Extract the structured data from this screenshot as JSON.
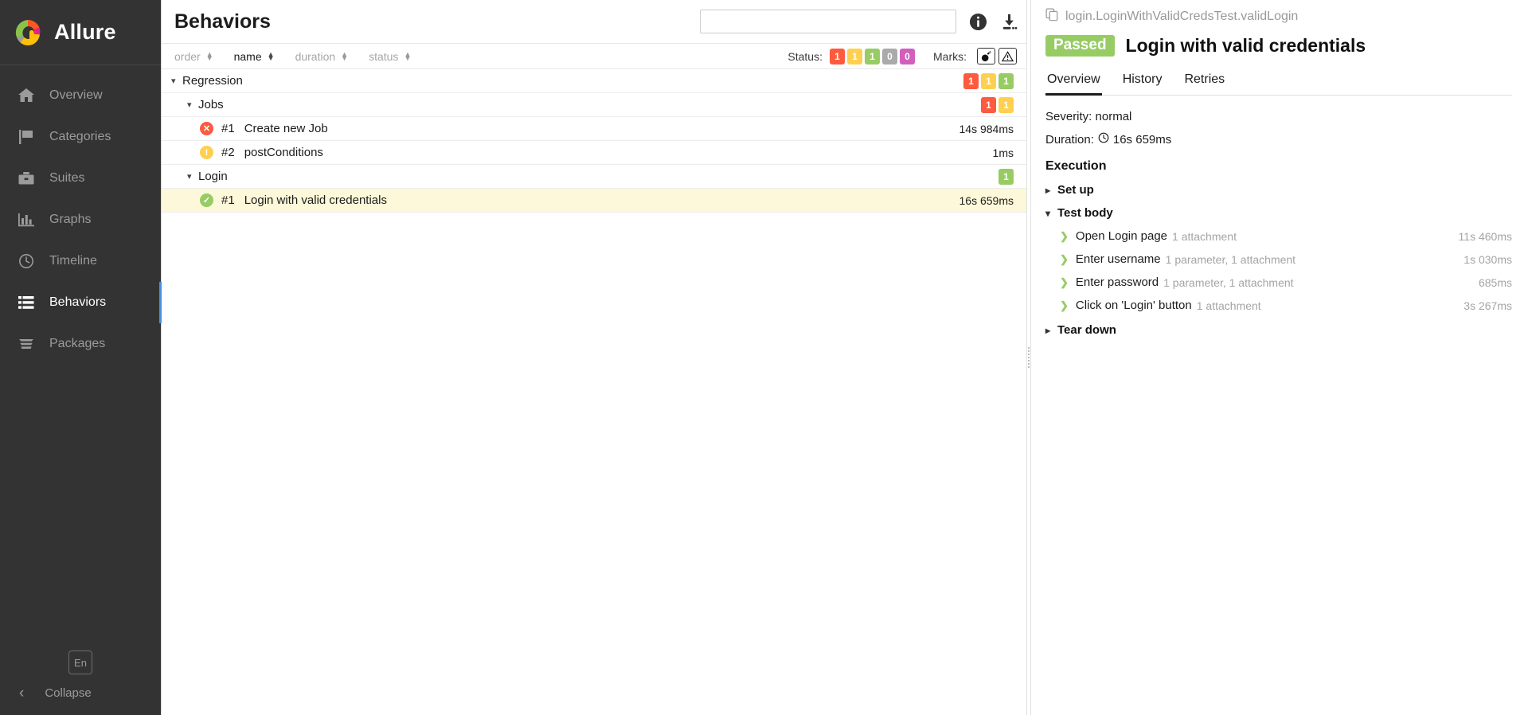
{
  "brand": {
    "name": "Allure",
    "logo_colors": [
      "#8bc34a",
      "#ff5722",
      "#e91e8c",
      "#ffc107",
      "#9e9e9e"
    ]
  },
  "sidebar": {
    "items": [
      {
        "label": "Overview",
        "icon": "home-icon",
        "active": false
      },
      {
        "label": "Categories",
        "icon": "flag-icon",
        "active": false
      },
      {
        "label": "Suites",
        "icon": "briefcase-icon",
        "active": false
      },
      {
        "label": "Graphs",
        "icon": "bar-chart-icon",
        "active": false
      },
      {
        "label": "Timeline",
        "icon": "clock-icon",
        "active": false
      },
      {
        "label": "Behaviors",
        "icon": "list-icon",
        "active": true
      },
      {
        "label": "Packages",
        "icon": "layers-icon",
        "active": false
      }
    ],
    "language_button": "En",
    "collapse_label": "Collapse"
  },
  "header": {
    "title": "Behaviors",
    "search_value": "",
    "search_placeholder": "",
    "info_icon": "info-icon",
    "download_icon": "download-icon"
  },
  "sortbar": {
    "sorters": [
      {
        "label": "order",
        "active": false
      },
      {
        "label": "name",
        "active": true
      },
      {
        "label": "duration",
        "active": false
      },
      {
        "label": "status",
        "active": false
      }
    ],
    "status_label": "Status:",
    "status_chips": [
      {
        "value": "1",
        "color": "#fd5a3e",
        "name": "failed"
      },
      {
        "value": "1",
        "color": "#ffd050",
        "name": "broken"
      },
      {
        "value": "1",
        "color": "#97cc64",
        "name": "passed"
      },
      {
        "value": "0",
        "color": "#aaaaaa",
        "name": "skipped"
      },
      {
        "value": "0",
        "color": "#d35ebe",
        "name": "unknown"
      }
    ],
    "marks_label": "Marks:",
    "marks": [
      {
        "name": "flaky-bomb-icon"
      },
      {
        "name": "warning-triangle-icon"
      }
    ]
  },
  "tree": {
    "rows": [
      {
        "level": 1,
        "type": "group",
        "expanded": true,
        "name": "Regression",
        "badges": [
          {
            "value": "1",
            "color": "#fd5a3e"
          },
          {
            "value": "1",
            "color": "#ffd050"
          },
          {
            "value": "1",
            "color": "#97cc64"
          }
        ],
        "duration": "",
        "selected": false
      },
      {
        "level": 2,
        "type": "group",
        "expanded": true,
        "name": "Jobs",
        "badges": [
          {
            "value": "1",
            "color": "#fd5a3e"
          },
          {
            "value": "1",
            "color": "#ffd050"
          }
        ],
        "duration": "",
        "selected": false
      },
      {
        "level": 3,
        "type": "test",
        "status": "failed",
        "status_color": "#fd5a3e",
        "index": "#1",
        "name": "Create new Job",
        "duration": "14s 984ms",
        "badges": [],
        "selected": false
      },
      {
        "level": 3,
        "type": "test",
        "status": "broken",
        "status_color": "#ffd050",
        "index": "#2",
        "name": "postConditions",
        "duration": "1ms",
        "badges": [],
        "selected": false
      },
      {
        "level": 2,
        "type": "group",
        "expanded": true,
        "name": "Login",
        "badges": [
          {
            "value": "1",
            "color": "#97cc64"
          }
        ],
        "duration": "",
        "selected": false
      },
      {
        "level": 3,
        "type": "test",
        "status": "passed",
        "status_color": "#97cc64",
        "index": "#1",
        "name": "Login with valid credentials",
        "duration": "16s 659ms",
        "badges": [],
        "selected": true
      }
    ]
  },
  "detail": {
    "copy_icon": "copy-icon",
    "path": "login.LoginWithValidCredsTest.validLogin",
    "status_badge": "Passed",
    "status_badge_color": "#97cc64",
    "title": "Login with valid credentials",
    "tabs": [
      {
        "label": "Overview",
        "active": true
      },
      {
        "label": "History",
        "active": false
      },
      {
        "label": "Retries",
        "active": false
      }
    ],
    "severity_line": "Severity: normal",
    "duration_label": "Duration:",
    "duration_value": "16s 659ms",
    "duration_icon": "clock-icon",
    "execution_title": "Execution",
    "groups": [
      {
        "label": "Set up",
        "expanded": false,
        "steps": []
      },
      {
        "label": "Test body",
        "expanded": true,
        "steps": [
          {
            "name": "Open Login page",
            "sub": "1 attachment",
            "time": "11s 460ms",
            "status": "passed"
          },
          {
            "name": "Enter username",
            "sub": "1 parameter, 1 attachment",
            "time": "1s 030ms",
            "status": "passed"
          },
          {
            "name": "Enter password",
            "sub": "1 parameter, 1 attachment",
            "time": "685ms",
            "status": "passed"
          },
          {
            "name": "Click on 'Login' button",
            "sub": "1 attachment",
            "time": "3s 267ms",
            "status": "passed"
          }
        ]
      },
      {
        "label": "Tear down",
        "expanded": false,
        "steps": []
      }
    ]
  }
}
